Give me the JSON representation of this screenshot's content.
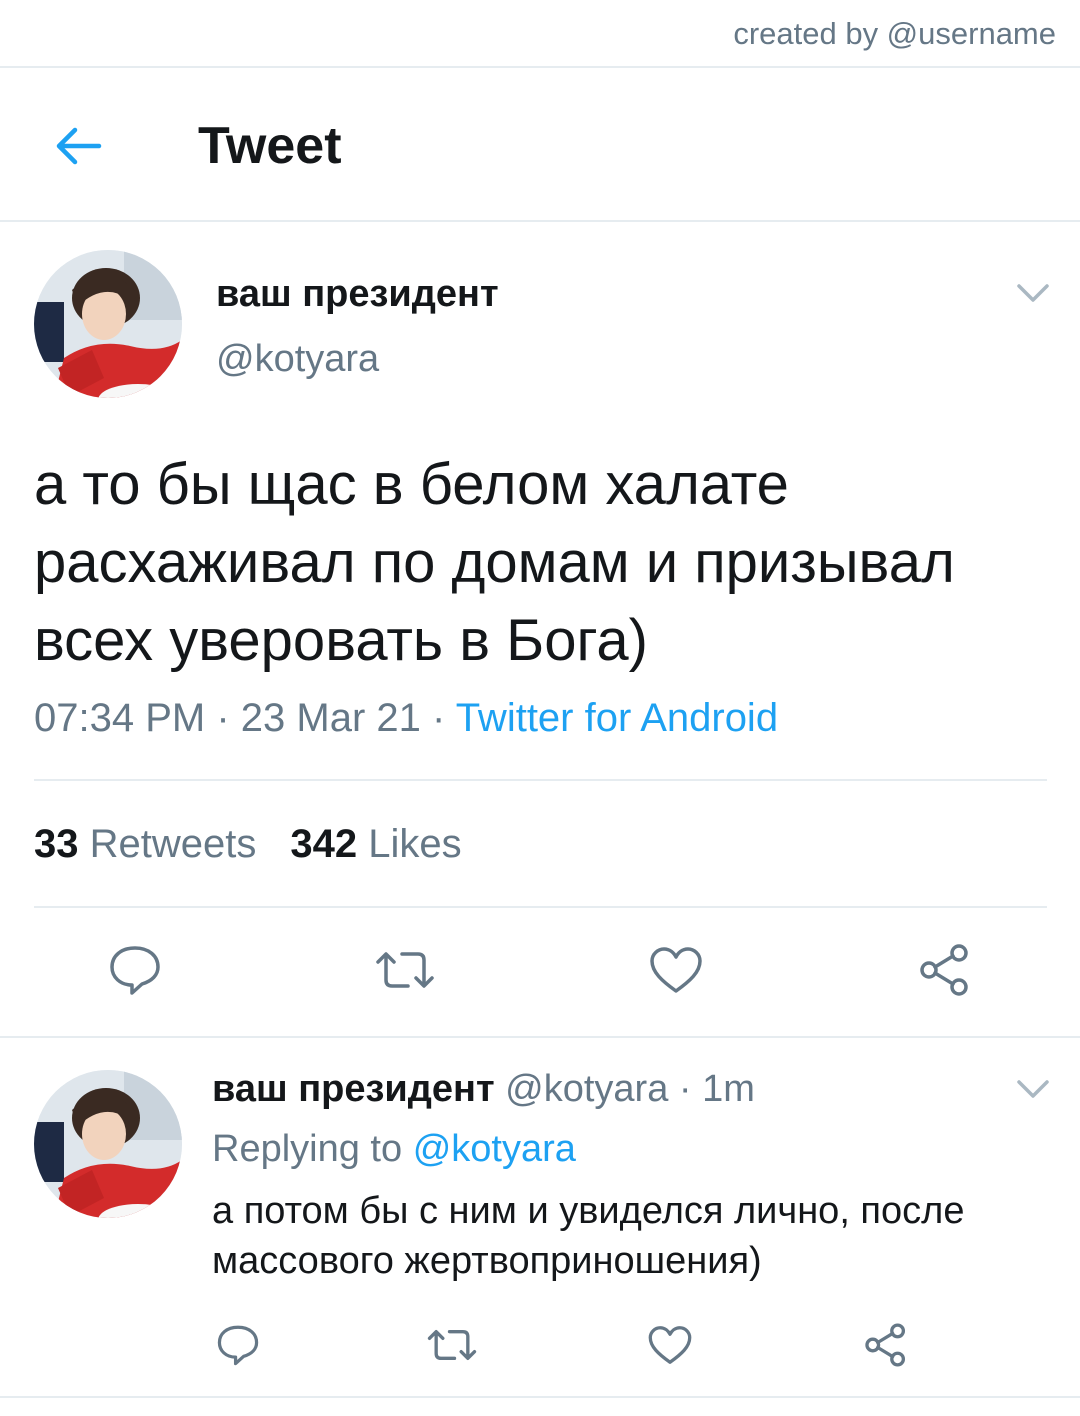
{
  "credit": "created by @username",
  "header": {
    "title": "Tweet"
  },
  "tweet": {
    "author_name": "ваш президент",
    "author_handle": "@kotyara",
    "text": "а то бы щас в белом халате расхаживал по домам и призывал всех уверовать в Бога)",
    "time": "07:34 PM",
    "date": "23 Mar 21",
    "source": "Twitter for Android",
    "retweets_count": "33",
    "retweets_label": "Retweets",
    "likes_count": "342",
    "likes_label": "Likes"
  },
  "reply": {
    "author_name": "ваш президент",
    "author_handle": "@kotyara",
    "age": "1m",
    "replying_prefix": "Replying to",
    "replying_to": "@kotyara",
    "text": "а потом бы с ним и увиделся лично, после массового жертвоприношения)"
  },
  "icons": {
    "back": "arrow-left",
    "menu": "chevron-down",
    "reply": "speech-bubble",
    "retweet": "retweet-arrows",
    "like": "heart-outline",
    "share": "share-nodes"
  },
  "colors": {
    "accent": "#1da1f2",
    "text": "#14171a",
    "secondary": "#657786",
    "divider": "#e6ecf0",
    "avatar_sweater": "#d32b2b"
  }
}
